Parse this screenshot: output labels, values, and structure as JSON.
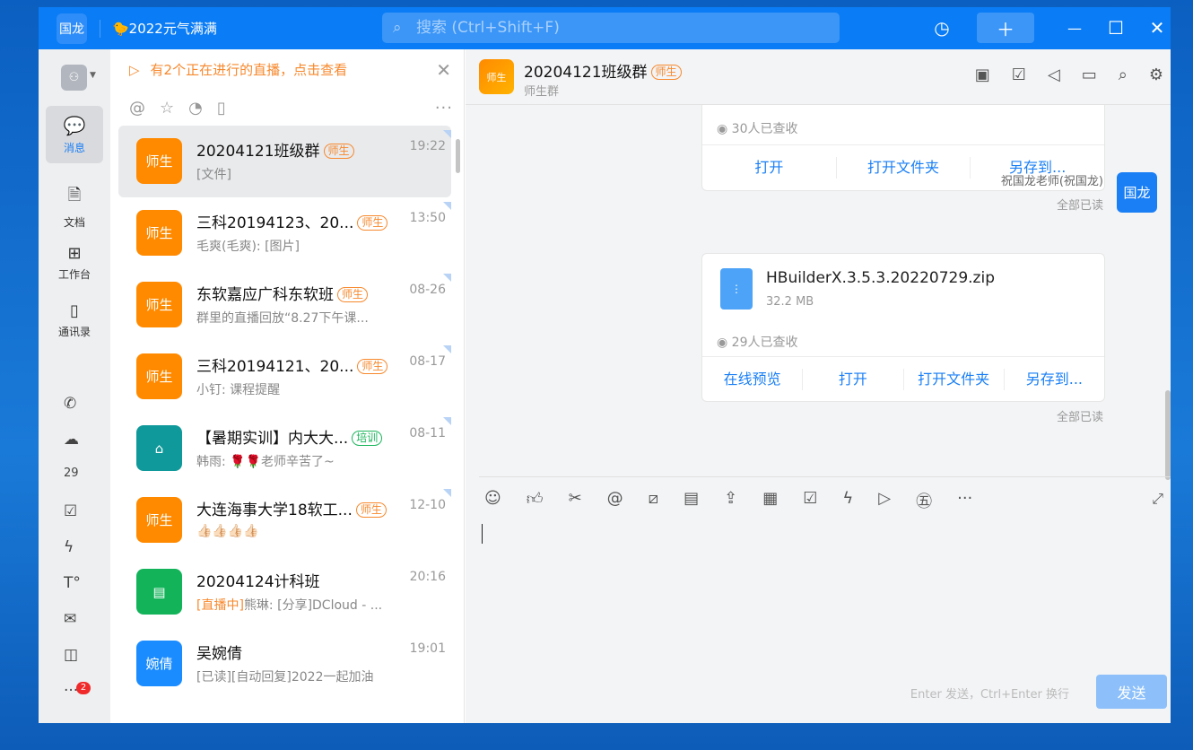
{
  "titlebar": {
    "user_avatar": "国龙",
    "status": "🐤2022元气满满",
    "search_placeholder": "搜索 (Ctrl+Shift+F)"
  },
  "nav": {
    "items": [
      {
        "label": "消息",
        "icon": "chat-icon"
      },
      {
        "label": "文档",
        "icon": "document-icon"
      },
      {
        "label": "工作台",
        "icon": "grid-icon"
      },
      {
        "label": "通讯录",
        "icon": "contacts-icon"
      }
    ],
    "more_badge": "2"
  },
  "banner": {
    "text": "有2个正在进行的直播，点击查看"
  },
  "conversations": [
    {
      "name": "20204121班级群",
      "tag": "师生",
      "time": "19:22",
      "preview": "[文件]",
      "avatar": "师生",
      "color": "#ff8a00"
    },
    {
      "name": "三科20194123、20...",
      "tag": "师生",
      "time": "13:50",
      "preview": "毛爽(毛爽): [图片]",
      "avatar": "师生",
      "color": "#ff8a00"
    },
    {
      "name": "东软嘉应广科东软班",
      "tag": "师生",
      "time": "08-26",
      "preview": "群里的直播回放“8.27下午课...",
      "avatar": "师生",
      "color": "#ff8a00"
    },
    {
      "name": "三科20194121、20...",
      "tag": "师生",
      "time": "08-17",
      "preview": "小钉: 课程提醒",
      "avatar": "师生",
      "color": "#ff8a00"
    },
    {
      "name": "【暑期实训】内大大...",
      "tag": "培训",
      "time": "08-11",
      "preview": "韩雨: 🌹🌹老师辛苦了~",
      "avatar": "",
      "color": "#10999a"
    },
    {
      "name": "大连海事大学18软工...",
      "tag": "师生",
      "time": "12-10",
      "preview": "👍🏻👍🏻👍🏻👍🏻",
      "avatar": "师生",
      "color": "#ff8a00"
    },
    {
      "name": "20204124计科班",
      "tag": "",
      "time": "20:16",
      "preview_prefix": "[直播中]",
      "preview": "熊琳: [分享]DCloud - ...",
      "avatar": "",
      "color": "#13b35a"
    },
    {
      "name": "吴婉倩",
      "tag": "",
      "time": "19:01",
      "preview": "[已读][自动回复]2022一起加油",
      "avatar": "婉倩",
      "color": "#1a8cff"
    }
  ],
  "chat": {
    "title": "20204121班级群",
    "tag": "师生",
    "subtitle": "师生群",
    "msg1": {
      "seen": "30人已查收",
      "actions": [
        "打开",
        "打开文件夹",
        "另存到..."
      ],
      "read": "全部已读"
    },
    "msg2": {
      "sender": "祝国龙老师(祝国龙)",
      "me_avatar": "国龙",
      "file_name": "HBuilderX.3.5.3.20220729.zip",
      "file_size": "32.2 MB",
      "seen": "29人已查收",
      "actions": [
        "在线预览",
        "打开",
        "打开文件夹",
        "另存到..."
      ],
      "read": "全部已读"
    },
    "hint": "Enter 发送，Ctrl+Enter 换行",
    "send": "发送"
  }
}
